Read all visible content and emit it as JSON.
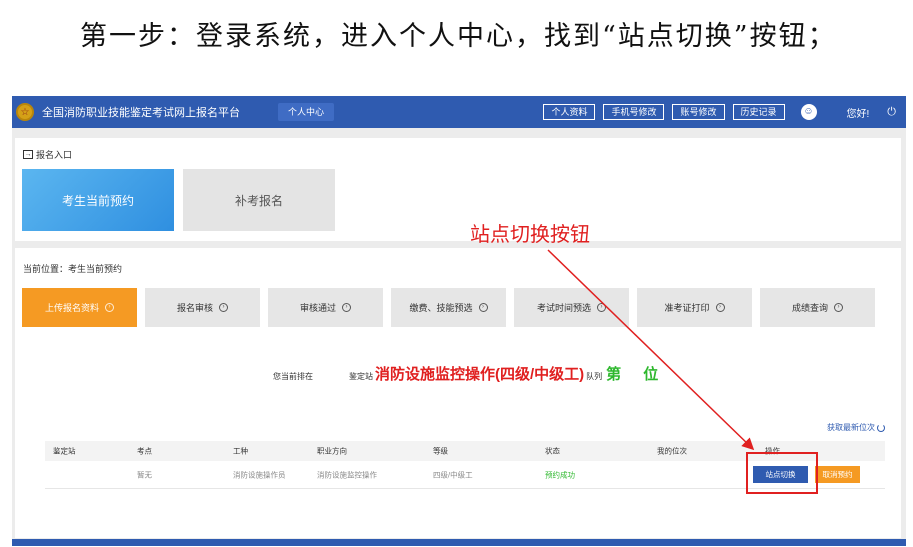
{
  "caption": "第一步：登录系统，进入个人中心，找到“站点切换”按钮；",
  "header": {
    "site_title": "全国消防职业技能鉴定考试网上报名平台",
    "nav_current": "个人中心",
    "buttons": [
      "个人资料",
      "手机号修改",
      "账号修改",
      "历史记录"
    ],
    "greeting": "您好!",
    "logo_glyph": "☆",
    "avatar_glyph": "☺",
    "power_glyph": "⏻"
  },
  "entry": {
    "label": "报名入口",
    "icon_glyph": "→",
    "tiles": [
      "考生当前预约",
      "补考报名"
    ]
  },
  "breadcrumb": "当前位置：考生当前预约",
  "steps": [
    {
      "label": "上传报名资料",
      "active": true
    },
    {
      "label": "报名审核",
      "active": false
    },
    {
      "label": "审核通过",
      "active": false
    },
    {
      "label": "缴费、技能预选",
      "active": false
    },
    {
      "label": "考试时间预选",
      "active": false
    },
    {
      "label": "准考证打印",
      "active": false
    },
    {
      "label": "成绩查询",
      "active": false
    }
  ],
  "step_dot_glyph": "›",
  "queue": {
    "prefix": "您当前排在",
    "station_label": "鉴定站",
    "station_value": "消防设施监控操作(四级/中级工)",
    "queue_label": "队列",
    "position_prefix": "第",
    "position_value": "",
    "position_suffix": "位"
  },
  "refresh_label": "获取最新位次",
  "table": {
    "headers": [
      "鉴定站",
      "考点",
      "工种",
      "职业方向",
      "等级",
      "状态",
      "我的位次",
      "操作"
    ],
    "rows": [
      {
        "station": "",
        "site": "暂无",
        "job": "消防设施操作员",
        "direction": "消防设施监控操作",
        "level": "四级/中级工",
        "status": "预约成功",
        "rank": "",
        "switch_label": "站点切换",
        "cancel_label": "取消预约"
      }
    ]
  },
  "annotation": {
    "label": "站点切换按钮"
  },
  "colors": {
    "primary": "#2f5bb0",
    "accent_orange": "#f59a23",
    "annotation_red": "#e02020",
    "success_green": "#2eb82e"
  }
}
